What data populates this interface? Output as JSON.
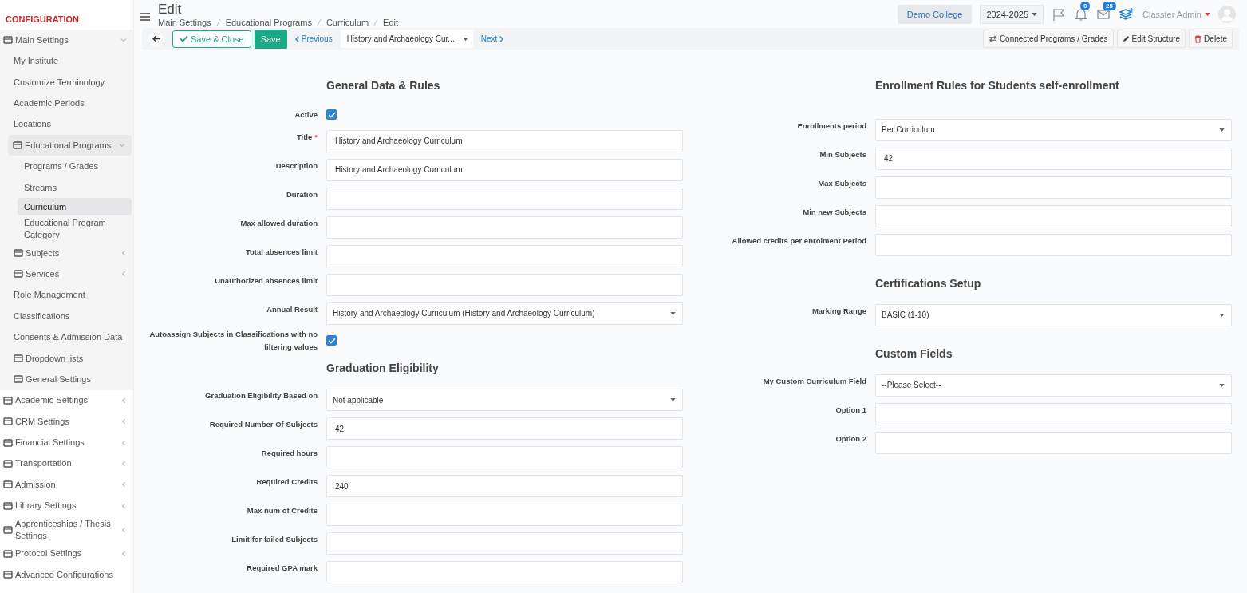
{
  "sidebar": {
    "title": "CONFIGURATION",
    "items": [
      {
        "kind": "group",
        "label": "Main Settings",
        "expanded": true,
        "selected": false,
        "children": [
          {
            "kind": "link",
            "label": "My Institute",
            "selected": false
          },
          {
            "kind": "link",
            "label": "Customize Terminology",
            "selected": false
          },
          {
            "kind": "link",
            "label": "Academic Periods",
            "selected": false
          },
          {
            "kind": "link",
            "label": "Locations",
            "selected": false
          },
          {
            "kind": "group",
            "label": "Educational Programs",
            "expanded": true,
            "selected": false,
            "children": [
              {
                "kind": "link",
                "label": "Programs / Grades",
                "selected": false
              },
              {
                "kind": "link",
                "label": "Streams",
                "selected": false
              },
              {
                "kind": "link",
                "label": "Curriculum",
                "selected": true
              },
              {
                "kind": "link",
                "label": "Educational Program Category",
                "selected": false
              }
            ]
          },
          {
            "kind": "group",
            "label": "Subjects",
            "expanded": false,
            "selected": false
          },
          {
            "kind": "group",
            "label": "Services",
            "expanded": false,
            "selected": false
          },
          {
            "kind": "link",
            "label": "Role Management",
            "selected": false
          },
          {
            "kind": "link",
            "label": "Classifications",
            "selected": false
          },
          {
            "kind": "link",
            "label": "Consents & Admission Data",
            "selected": false
          },
          {
            "kind": "icon_link",
            "label": "Dropdown lists",
            "selected": false
          },
          {
            "kind": "icon_link",
            "label": "General Settings",
            "selected": false
          }
        ]
      },
      {
        "kind": "group",
        "label": "Academic Settings",
        "expanded": false,
        "selected": false
      },
      {
        "kind": "group",
        "label": "CRM Settings",
        "expanded": false,
        "selected": false
      },
      {
        "kind": "group",
        "label": "Financial Settings",
        "expanded": false,
        "selected": false
      },
      {
        "kind": "group",
        "label": "Transportation",
        "expanded": false,
        "selected": false
      },
      {
        "kind": "group",
        "label": "Admission",
        "expanded": false,
        "selected": false
      },
      {
        "kind": "group",
        "label": "Library Settings",
        "expanded": false,
        "selected": false
      },
      {
        "kind": "group",
        "label": "Apprenticeships / Thesis Settings",
        "expanded": false,
        "selected": false
      },
      {
        "kind": "group",
        "label": "Protocol Settings",
        "expanded": false,
        "selected": false
      },
      {
        "kind": "icon_link",
        "label": "Advanced Configurations",
        "selected": false
      }
    ]
  },
  "header": {
    "title": "Edit",
    "breadcrumb": [
      "Main Settings",
      "Educational Programs",
      "Curriculum",
      "Edit"
    ],
    "institution": "Demo College",
    "year": "2024-2025",
    "notifications": "0",
    "messages": "25",
    "user": "Classter Admin"
  },
  "toolbar": {
    "save_close": "Save & Close",
    "save": "Save",
    "previous": "Previous",
    "record": "History and Archaeology Cur...",
    "next": "Next",
    "actions": [
      "Connected Programs / Grades",
      "Edit Structure",
      "Delete"
    ]
  },
  "required_mark": "*",
  "columns": [
    {
      "sections": [
        {
          "title": "General Data & Rules",
          "fields": [
            {
              "label": "Active",
              "kind": "checkbox",
              "checked": true,
              "required": false
            },
            {
              "label": "Title",
              "kind": "text",
              "value": "History and Archaeology Curriculum",
              "required": true
            },
            {
              "label": "Description",
              "kind": "text",
              "value": "History and Archaeology Curriculum",
              "required": false
            },
            {
              "label": "Duration",
              "kind": "text",
              "required": false
            },
            {
              "label": "Max allowed duration",
              "kind": "text",
              "required": false
            },
            {
              "label": "Total absences limit",
              "kind": "text",
              "required": false
            },
            {
              "label": "Unauthorized absences limit",
              "kind": "text",
              "required": false
            },
            {
              "label": "Annual Result",
              "kind": "select",
              "value": "History and Archaeology Curriculum (History and Archaeology Curriculum)",
              "required": false
            },
            {
              "label": "Autoassign Subjects in Classifications with no filtering values",
              "kind": "checkbox",
              "checked": true,
              "required": false
            }
          ]
        },
        {
          "title": "Graduation Eligibility",
          "fields": [
            {
              "label": "Graduation Eligibility Based on",
              "kind": "select",
              "value": "Not applicable",
              "required": false
            },
            {
              "label": "Required Number Of Subjects",
              "kind": "text",
              "value": "42",
              "required": false
            },
            {
              "label": "Required hours",
              "kind": "text",
              "required": false
            },
            {
              "label": "Required Credits",
              "kind": "text",
              "value": "240",
              "required": false
            },
            {
              "label": "Max num of Credits",
              "kind": "text",
              "required": false
            },
            {
              "label": "Limit for failed Subjects",
              "kind": "text",
              "required": false
            },
            {
              "label": "Required GPA mark",
              "kind": "text",
              "required": false
            }
          ]
        }
      ]
    },
    {
      "sections": [
        {
          "title": "Enrollment Rules for Students self-enrollment",
          "fields": [
            {
              "label": "Enrollments period",
              "kind": "select",
              "value": "Per Curriculum",
              "required": false
            },
            {
              "label": "Min Subjects",
              "kind": "text",
              "value": "42",
              "required": false
            },
            {
              "label": "Max Subjects",
              "kind": "text",
              "required": false
            },
            {
              "label": "Min new Subjects",
              "kind": "text",
              "required": false
            },
            {
              "label": "Allowed credits per enrolment Period",
              "kind": "text",
              "required": false
            }
          ]
        },
        {
          "title": "Certifications Setup",
          "fields": [
            {
              "label": "Marking Range",
              "kind": "select",
              "value": "BASIC (1-10)",
              "required": false
            }
          ]
        },
        {
          "title": "Custom Fields",
          "fields": [
            {
              "label": "My Custom Curriculum Field",
              "kind": "select",
              "value": "--Please Select--",
              "required": false
            },
            {
              "label": "Option 1",
              "kind": "text",
              "required": false
            },
            {
              "label": "Option 2",
              "kind": "text",
              "required": false
            }
          ]
        }
      ]
    }
  ]
}
